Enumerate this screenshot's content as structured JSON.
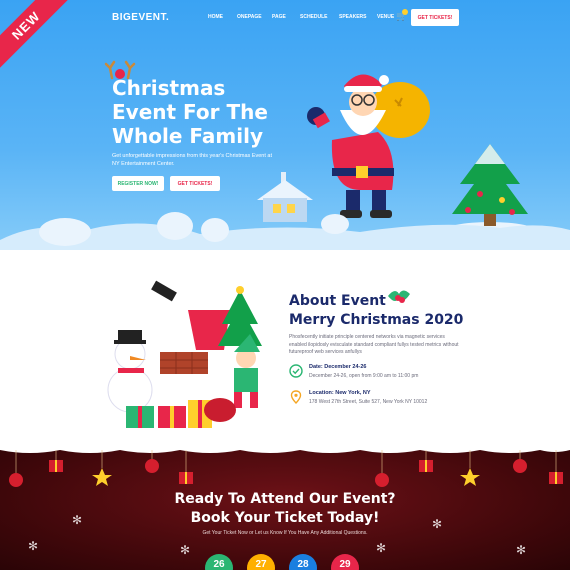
{
  "ribbon": "NEW",
  "nav": {
    "logo": "BIGEVENT.",
    "items": [
      "HOME",
      "ONEPAGE",
      "PAGE",
      "SCHEDULE",
      "SPEAKERS",
      "VENUE"
    ],
    "ticket_button": "GET TICKETS!"
  },
  "hero": {
    "title_lines": [
      "Christmas",
      "Event For The",
      "Whole Family"
    ],
    "subtitle": "Get unforgettable impressions from this year's Christmas Event at NY Entertainment Center.",
    "register_button": "REGISTER NOW!",
    "tickets_button": "GET TICKETS!"
  },
  "about": {
    "title_lines": [
      "About Event",
      "Merry Christmas 2020"
    ],
    "text": "Phosfecently initiate principle centered networks via magnetic services enabled ilopidosly evisculate standard compliant fullys tested metrics without futureproof web services anfullys",
    "date_title": "Date: December 24-26",
    "date_detail": "December 24-26, open from 9:00 am to 11:00 pm",
    "location_title": "Location: New York, NY",
    "location_detail": "178 West 27th Street, Suite 527, New York NY 10012"
  },
  "cta": {
    "title_lines": [
      "Ready To Attend Our Event?",
      "Book Your Ticket Today!"
    ],
    "subtitle": "Get Your Ticket Now or Let us Know If You Have Any Additional Questions.",
    "countdown": [
      {
        "value": "26",
        "color": "#2bb673"
      },
      {
        "value": "27",
        "color": "#ffb000"
      },
      {
        "value": "28",
        "color": "#1a7fe0"
      },
      {
        "value": "29",
        "color": "#e8264a"
      }
    ]
  },
  "colors": {
    "hero_sky": "#3aa3f3",
    "accent_red": "#e8264a",
    "accent_green": "#2bb673",
    "navy": "#1b2a6b"
  }
}
